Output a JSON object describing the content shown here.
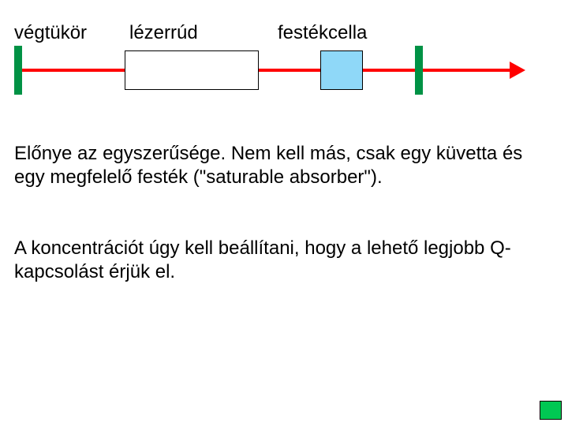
{
  "labels": {
    "mirror": "végtükör",
    "rod": "lézerrúd",
    "dye": "festékcella"
  },
  "paragraphs": {
    "p1": "Előnye az egyszerűsége. Nem kell más, csak egy küvetta és egy megfelelő festék (\"saturable absorber\").",
    "p2": "A koncentrációt úgy kell beállítani, hogy a lehető legjobb Q-kapcsolást érjük el."
  }
}
